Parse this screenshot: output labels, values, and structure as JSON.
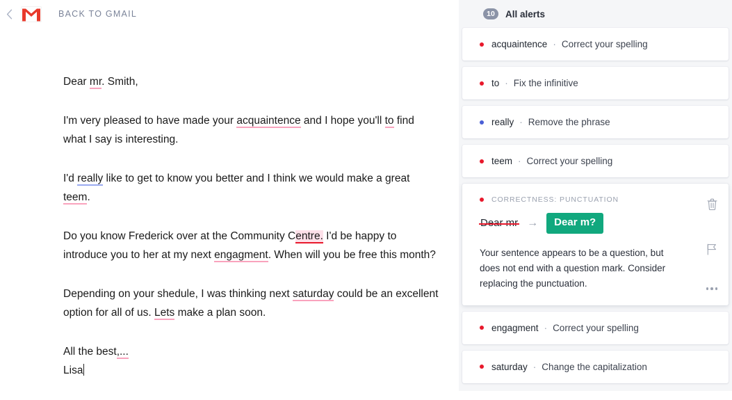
{
  "topbar": {
    "back_chevron_icon": "chevron-left-icon",
    "logo_icon": "gmail-logo-icon",
    "back_label": "BACK TO GMAIL"
  },
  "document": {
    "paragraphs": [
      {
        "id": "greeting",
        "parts": [
          {
            "t": "Dear ",
            "s": "plain"
          },
          {
            "t": "mr",
            "s": "err"
          },
          {
            "t": ". Smith,",
            "s": "plain"
          }
        ]
      },
      {
        "id": "para-1",
        "parts": [
          {
            "t": "I'm very pleased to have made your ",
            "s": "plain"
          },
          {
            "t": "acquaintence",
            "s": "err"
          },
          {
            "t": " and I hope you'll ",
            "s": "plain"
          },
          {
            "t": "to",
            "s": "err"
          },
          {
            "t": " find what I say is interesting.",
            "s": "plain"
          }
        ]
      },
      {
        "id": "para-2",
        "parts": [
          {
            "t": "I'd ",
            "s": "plain"
          },
          {
            "t": "really",
            "s": "err-blue"
          },
          {
            "t": " like to get to know you better and I think we would make a great ",
            "s": "plain"
          },
          {
            "t": "teem",
            "s": "err"
          },
          {
            "t": ".",
            "s": "plain"
          }
        ]
      },
      {
        "id": "para-3",
        "parts": [
          {
            "t": "Do you know Frederick over at the Community C",
            "s": "plain"
          },
          {
            "t": "entre.",
            "s": "err-active"
          },
          {
            "t": " I'd be happy to introduce you to her at my next ",
            "s": "plain"
          },
          {
            "t": "engagment",
            "s": "err"
          },
          {
            "t": ". When will you be free this month?",
            "s": "plain"
          }
        ]
      },
      {
        "id": "para-4",
        "parts": [
          {
            "t": "Depending on your shedule, I was thinking next ",
            "s": "plain"
          },
          {
            "t": "saturday",
            "s": "err"
          },
          {
            "t": " could be an excellent option for all of us. ",
            "s": "plain"
          },
          {
            "t": "Lets",
            "s": "err"
          },
          {
            "t": " make a plan soon.",
            "s": "plain"
          }
        ]
      },
      {
        "id": "signoff",
        "parts": [
          {
            "t": "All the best",
            "s": "plain"
          },
          {
            "t": ",...",
            "s": "err"
          }
        ]
      },
      {
        "id": "signature",
        "parts": [
          {
            "t": "Lisa",
            "s": "plain"
          },
          {
            "t": "",
            "s": "caret"
          }
        ]
      }
    ]
  },
  "alerts": {
    "badge_count": "10",
    "title": "All alerts",
    "items_top": [
      {
        "word": "acquaintence",
        "separator": "·",
        "action": "Correct your spelling",
        "severity": "red"
      },
      {
        "word": "to",
        "separator": "·",
        "action": "Fix the infinitive",
        "severity": "red"
      },
      {
        "word": "really",
        "separator": "·",
        "action": "Remove the phrase",
        "severity": "blue"
      },
      {
        "word": "teem",
        "separator": "·",
        "action": "Correct your spelling",
        "severity": "red"
      }
    ],
    "expanded": {
      "severity": "red",
      "label": "CORRECTNESS: PUNCTUATION",
      "original": "Dear mr",
      "arrow": "→",
      "suggestion": "Dear m?",
      "description": "Your sentence appears to be a question, but does not end with a question mark. Consider replacing the punctuation.",
      "delete_icon": "trash-icon",
      "flag_icon": "flag-icon",
      "more_icon": "more-options-icon"
    },
    "items_bottom": [
      {
        "word": "engagment",
        "separator": "·",
        "action": "Correct your spelling",
        "severity": "red"
      },
      {
        "word": "saturday",
        "separator": "·",
        "action": "Change the capitalization",
        "severity": "red"
      }
    ]
  },
  "colors": {
    "accent_green": "#11a87e",
    "error_red": "#e8192c",
    "error_underline": "#f9a3bd",
    "suggestion_blue": "#4a5fd6",
    "panel_bg": "#f5f6f8",
    "badge_gray": "#8b93a7"
  }
}
